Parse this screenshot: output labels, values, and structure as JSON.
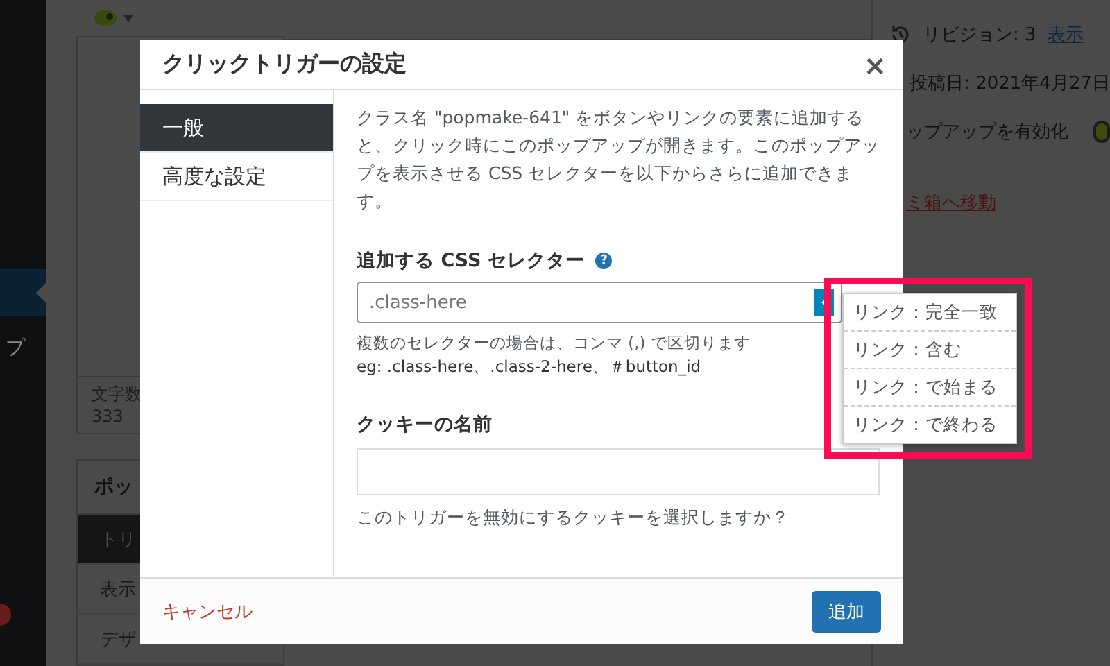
{
  "admin_sidebar": {
    "items": [
      {
        "label": "プ"
      }
    ]
  },
  "editor": {
    "word_count": {
      "label": "文字数",
      "value": "333"
    },
    "popup_settings": {
      "title": "ポッ",
      "tabs": [
        {
          "label": "トリ",
          "selected": true
        },
        {
          "label": "表示",
          "selected": false
        },
        {
          "label": "デザ",
          "selected": false
        }
      ]
    }
  },
  "publish_box": {
    "revisions": {
      "label": "リビジョン: 3",
      "link": "表示"
    },
    "published_on": "投稿日: 2021年4月27日",
    "enable_popup": {
      "label": "ップアップを有効化",
      "on": true
    },
    "trash_link": "ミ箱へ移動"
  },
  "modal": {
    "title": "クリックトリガーの設定",
    "close": "×",
    "tabs": [
      {
        "label": "一般",
        "selected": true
      },
      {
        "label": "高度な設定",
        "selected": false
      }
    ],
    "description": "クラス名 \"popmake-641\" をボタンやリンクの要素に追加すると、クリック時にこのポップアップが開きます。このポップアップを表示させる CSS セレクターを以下からさらに追加できます。",
    "selector_field": {
      "label": "追加する CSS セレクター",
      "help": "?",
      "placeholder": ".class-here",
      "hint": "複数のセレクターの場合は、コンマ (,) で区切ります",
      "example": "eg: .class-here、.class-2-here、＃button_id",
      "options": [
        "リンク：完全一致",
        "リンク：含む",
        "リンク：で始まる",
        "リンク：で終わる"
      ]
    },
    "cookie_field": {
      "label": "クッキーの名前",
      "hint": "このトリガーを無効にするクッキーを選択しますか？"
    },
    "cancel": "キャンセル",
    "submit": "追加"
  }
}
